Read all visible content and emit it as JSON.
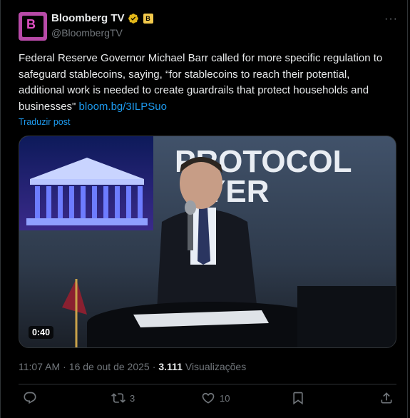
{
  "author": {
    "name": "Bloomberg TV",
    "handle": "@BloombergTV",
    "avatar_letter": "B",
    "org_badge": "B"
  },
  "tweet": {
    "text": "Federal Reserve Governor Michael Barr called for more specific regulation to safeguard stablecoins, saying, “for stablecoins to reach their potential, additional work is needed to create guardrails that protect households and businesses\" ",
    "link": "bloom.bg/3ILPSuo",
    "translate": "Traduzir post"
  },
  "media": {
    "duration": "0:40",
    "screen_text_line1": "PROTOCOL",
    "screen_text_line2": "YER"
  },
  "meta": {
    "time": "11:07 AM",
    "sep1": "·",
    "date": "16 de out de 2025",
    "sep2": "·",
    "views_count": "3.111",
    "views_label": "Visualizações"
  },
  "actions": {
    "reply_count": "",
    "retweet_count": "3",
    "like_count": "10"
  },
  "icons": [
    "reply-icon",
    "retweet-icon",
    "like-icon",
    "bookmark-icon",
    "share-icon",
    "more-icon",
    "verified-icon"
  ],
  "colors": {
    "background": "#000000",
    "text": "#e7e9ea",
    "secondary": "#71767b",
    "link": "#1d9bf0",
    "verified": "#e2b719"
  }
}
